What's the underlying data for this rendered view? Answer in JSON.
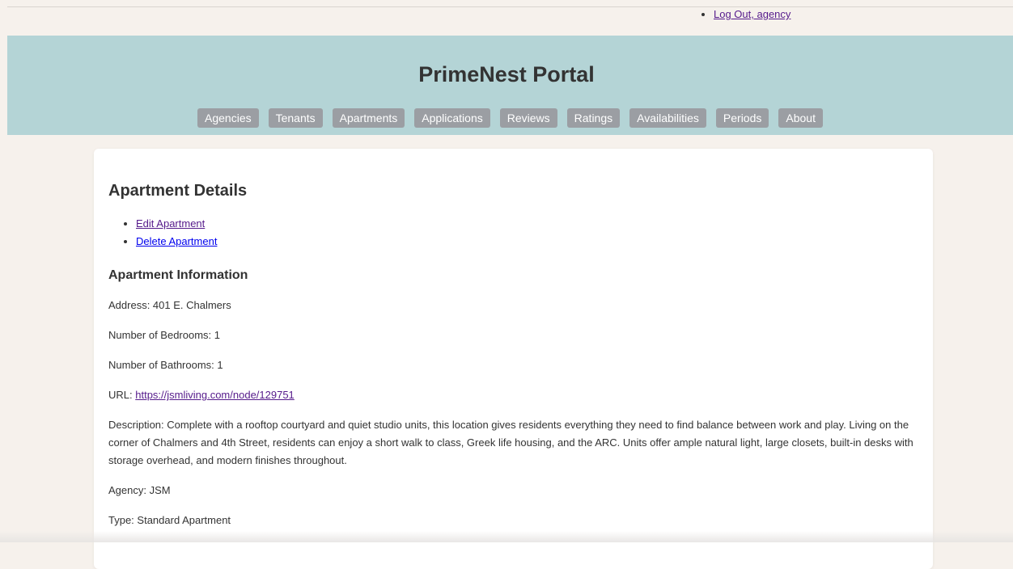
{
  "user_menu": {
    "logout_label": "Log Out, agency"
  },
  "header": {
    "title": "PrimeNest Portal",
    "nav": [
      "Agencies",
      "Tenants",
      "Apartments",
      "Applications",
      "Reviews",
      "Ratings",
      "Availabilities",
      "Periods",
      "About"
    ]
  },
  "main": {
    "title": "Apartment Details",
    "actions": {
      "edit": "Edit Apartment",
      "delete": "Delete Apartment"
    },
    "section_title": "Apartment Information",
    "fields": {
      "address": "Address: 401 E. Chalmers",
      "bedrooms": "Number of Bedrooms: 1",
      "bathrooms": "Number of Bathrooms: 1",
      "url_label": "URL: ",
      "url": "https://jsmliving.com/node/129751",
      "description": "Description: Complete with a rooftop courtyard and quiet studio units, this location gives residents everything they need to find balance between work and play. Living on the corner of Chalmers and 4th Street, residents can enjoy a short walk to class, Greek life housing, and the ARC. Units offer ample natural light, large closets, built-in desks with storage overhead, and modern finishes throughout.",
      "agency": "Agency: JSM",
      "type": "Type: Standard Apartment"
    }
  },
  "colors": {
    "page_bg": "#f6f1ec",
    "header_bg": "#b4d4d6",
    "nav_button_bg": "#9b9ea3",
    "visited_link": "#551a8b",
    "link": "#0000ee"
  }
}
